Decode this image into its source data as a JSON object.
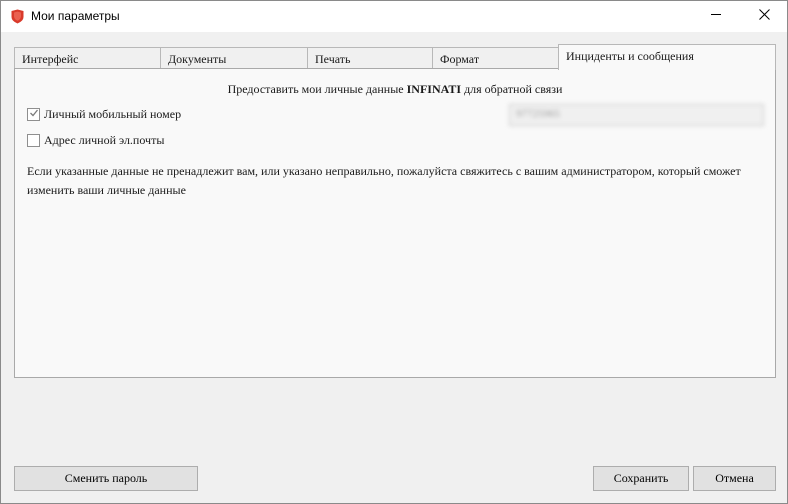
{
  "window": {
    "title": "Мои параметры",
    "icons": {
      "app": "shield-icon",
      "minimize": "minimize-icon",
      "close": "close-icon"
    },
    "accent_color": "#d93a2b"
  },
  "tabs": [
    {
      "label": "Интерфейс"
    },
    {
      "label": "Документы"
    },
    {
      "label": "Печать"
    },
    {
      "label": "Формат"
    },
    {
      "label": "Инциденты и сообщения",
      "active": true
    }
  ],
  "incidents": {
    "heading_prefix": "Предоставить мои личные данные",
    "heading_brand": "INFINATI",
    "heading_suffix": "для обратной связи",
    "mobile_label": "Личный мобильный номер",
    "mobile_checked": true,
    "mobile_value": "97725965",
    "email_label": "Адрес личной эл.почты",
    "email_checked": false,
    "info_text": "Если указанные данные не пренадлежит вам, или указано неправильно, пожалуйста свяжитесь с вашим администратором, который сможет изменить ваши личные данные"
  },
  "footer": {
    "change_password": "Сменить пароль",
    "save": "Сохранить",
    "cancel": "Отмена"
  }
}
